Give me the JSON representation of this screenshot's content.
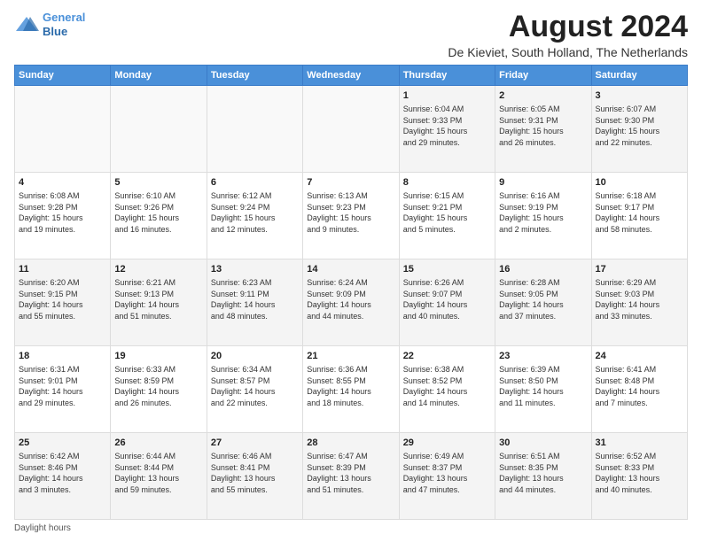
{
  "logo": {
    "line1": "General",
    "line2": "Blue"
  },
  "title": "August 2024",
  "subtitle": "De Kieviet, South Holland, The Netherlands",
  "days_of_week": [
    "Sunday",
    "Monday",
    "Tuesday",
    "Wednesday",
    "Thursday",
    "Friday",
    "Saturday"
  ],
  "footer": "Daylight hours",
  "weeks": [
    [
      {
        "num": "",
        "info": "",
        "empty": true
      },
      {
        "num": "",
        "info": "",
        "empty": true
      },
      {
        "num": "",
        "info": "",
        "empty": true
      },
      {
        "num": "",
        "info": "",
        "empty": true
      },
      {
        "num": "1",
        "info": "Sunrise: 6:04 AM\nSunset: 9:33 PM\nDaylight: 15 hours\nand 29 minutes."
      },
      {
        "num": "2",
        "info": "Sunrise: 6:05 AM\nSunset: 9:31 PM\nDaylight: 15 hours\nand 26 minutes."
      },
      {
        "num": "3",
        "info": "Sunrise: 6:07 AM\nSunset: 9:30 PM\nDaylight: 15 hours\nand 22 minutes."
      }
    ],
    [
      {
        "num": "4",
        "info": "Sunrise: 6:08 AM\nSunset: 9:28 PM\nDaylight: 15 hours\nand 19 minutes."
      },
      {
        "num": "5",
        "info": "Sunrise: 6:10 AM\nSunset: 9:26 PM\nDaylight: 15 hours\nand 16 minutes."
      },
      {
        "num": "6",
        "info": "Sunrise: 6:12 AM\nSunset: 9:24 PM\nDaylight: 15 hours\nand 12 minutes."
      },
      {
        "num": "7",
        "info": "Sunrise: 6:13 AM\nSunset: 9:23 PM\nDaylight: 15 hours\nand 9 minutes."
      },
      {
        "num": "8",
        "info": "Sunrise: 6:15 AM\nSunset: 9:21 PM\nDaylight: 15 hours\nand 5 minutes."
      },
      {
        "num": "9",
        "info": "Sunrise: 6:16 AM\nSunset: 9:19 PM\nDaylight: 15 hours\nand 2 minutes."
      },
      {
        "num": "10",
        "info": "Sunrise: 6:18 AM\nSunset: 9:17 PM\nDaylight: 14 hours\nand 58 minutes."
      }
    ],
    [
      {
        "num": "11",
        "info": "Sunrise: 6:20 AM\nSunset: 9:15 PM\nDaylight: 14 hours\nand 55 minutes."
      },
      {
        "num": "12",
        "info": "Sunrise: 6:21 AM\nSunset: 9:13 PM\nDaylight: 14 hours\nand 51 minutes."
      },
      {
        "num": "13",
        "info": "Sunrise: 6:23 AM\nSunset: 9:11 PM\nDaylight: 14 hours\nand 48 minutes."
      },
      {
        "num": "14",
        "info": "Sunrise: 6:24 AM\nSunset: 9:09 PM\nDaylight: 14 hours\nand 44 minutes."
      },
      {
        "num": "15",
        "info": "Sunrise: 6:26 AM\nSunset: 9:07 PM\nDaylight: 14 hours\nand 40 minutes."
      },
      {
        "num": "16",
        "info": "Sunrise: 6:28 AM\nSunset: 9:05 PM\nDaylight: 14 hours\nand 37 minutes."
      },
      {
        "num": "17",
        "info": "Sunrise: 6:29 AM\nSunset: 9:03 PM\nDaylight: 14 hours\nand 33 minutes."
      }
    ],
    [
      {
        "num": "18",
        "info": "Sunrise: 6:31 AM\nSunset: 9:01 PM\nDaylight: 14 hours\nand 29 minutes."
      },
      {
        "num": "19",
        "info": "Sunrise: 6:33 AM\nSunset: 8:59 PM\nDaylight: 14 hours\nand 26 minutes."
      },
      {
        "num": "20",
        "info": "Sunrise: 6:34 AM\nSunset: 8:57 PM\nDaylight: 14 hours\nand 22 minutes."
      },
      {
        "num": "21",
        "info": "Sunrise: 6:36 AM\nSunset: 8:55 PM\nDaylight: 14 hours\nand 18 minutes."
      },
      {
        "num": "22",
        "info": "Sunrise: 6:38 AM\nSunset: 8:52 PM\nDaylight: 14 hours\nand 14 minutes."
      },
      {
        "num": "23",
        "info": "Sunrise: 6:39 AM\nSunset: 8:50 PM\nDaylight: 14 hours\nand 11 minutes."
      },
      {
        "num": "24",
        "info": "Sunrise: 6:41 AM\nSunset: 8:48 PM\nDaylight: 14 hours\nand 7 minutes."
      }
    ],
    [
      {
        "num": "25",
        "info": "Sunrise: 6:42 AM\nSunset: 8:46 PM\nDaylight: 14 hours\nand 3 minutes."
      },
      {
        "num": "26",
        "info": "Sunrise: 6:44 AM\nSunset: 8:44 PM\nDaylight: 13 hours\nand 59 minutes."
      },
      {
        "num": "27",
        "info": "Sunrise: 6:46 AM\nSunset: 8:41 PM\nDaylight: 13 hours\nand 55 minutes."
      },
      {
        "num": "28",
        "info": "Sunrise: 6:47 AM\nSunset: 8:39 PM\nDaylight: 13 hours\nand 51 minutes."
      },
      {
        "num": "29",
        "info": "Sunrise: 6:49 AM\nSunset: 8:37 PM\nDaylight: 13 hours\nand 47 minutes."
      },
      {
        "num": "30",
        "info": "Sunrise: 6:51 AM\nSunset: 8:35 PM\nDaylight: 13 hours\nand 44 minutes."
      },
      {
        "num": "31",
        "info": "Sunrise: 6:52 AM\nSunset: 8:33 PM\nDaylight: 13 hours\nand 40 minutes."
      }
    ]
  ]
}
